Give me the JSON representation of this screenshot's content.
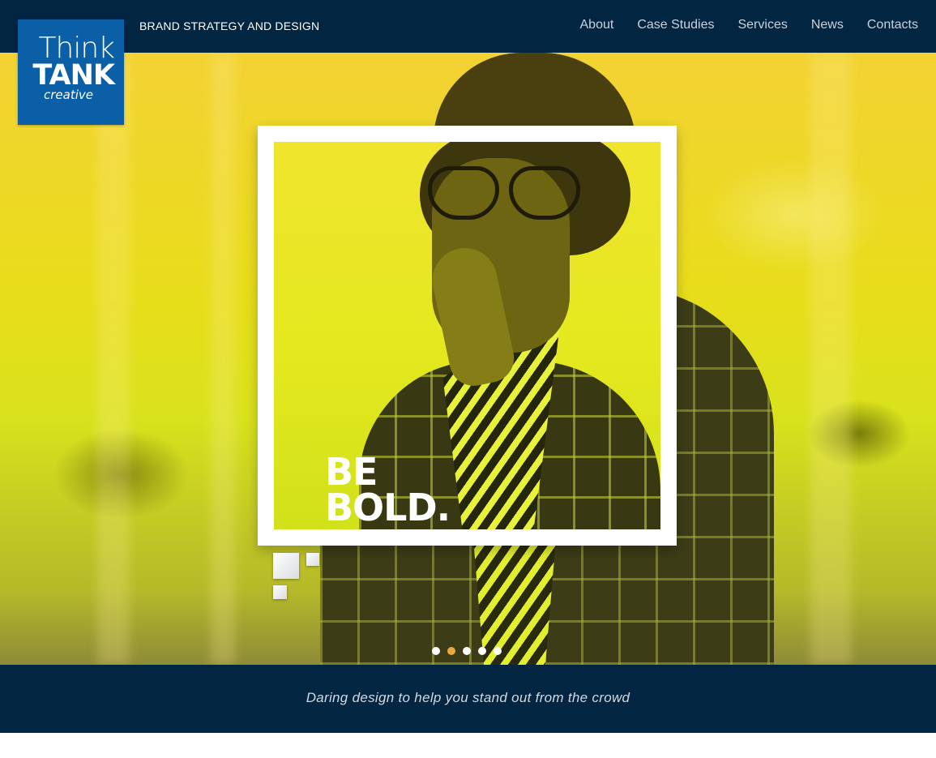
{
  "header": {
    "tagline": "BRAND STRATEGY AND DESIGN",
    "nav": [
      "About",
      "Case Studies",
      "Services",
      "News",
      "Contacts"
    ]
  },
  "logo": {
    "line1": "Think",
    "line2": "TANK",
    "line3": "creative",
    "background": "#0a5fa6"
  },
  "hero": {
    "headline_line1": "BE",
    "headline_line2": "BOLD.",
    "slide_count": 5,
    "active_slide": 2,
    "tint": "#e8dd1a"
  },
  "footer": {
    "tagline": "Daring design to help you stand out from the crowd"
  },
  "colors": {
    "navy": "#022542",
    "accent_dot": "#e9a73c"
  }
}
